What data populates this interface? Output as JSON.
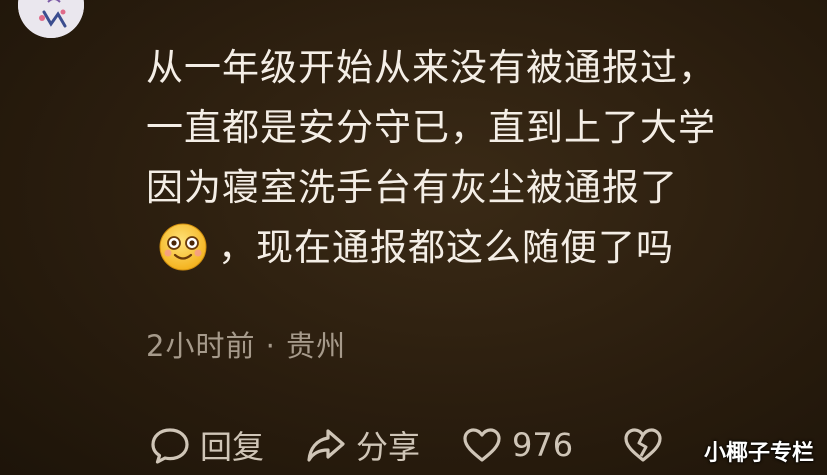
{
  "comment": {
    "lines": [
      "从一年级开始从来没有被通报过，",
      "一直都是安分守已，直到上了大学",
      "因为寝室洗手台有灰尘被通报了",
      "，现在通报都这么随便了吗"
    ],
    "emoji_icon": "smiling-face-emoji"
  },
  "meta": {
    "time": "2小时前",
    "separator": "·",
    "location": "贵州"
  },
  "actions": {
    "reply_label": "回复",
    "share_label": "分享",
    "like_count": "976"
  },
  "watermark": "小椰子专栏",
  "colors": {
    "background": "#2a1d0e",
    "text": "#f4eee6",
    "meta_text": "#a69a8b",
    "action_text": "#cfc5b7"
  }
}
